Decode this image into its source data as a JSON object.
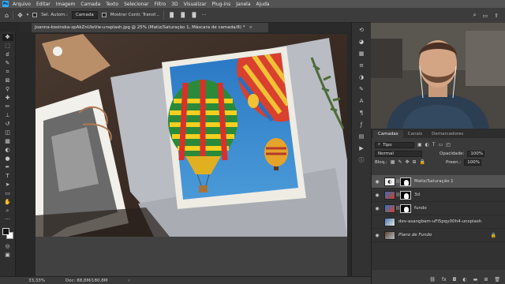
{
  "menu": {
    "logo": "Ps",
    "items": [
      "Arquivo",
      "Editar",
      "Imagem",
      "Camada",
      "Texto",
      "Selecionar",
      "Filtro",
      "3D",
      "Visualizar",
      "Plug-ins",
      "Janela",
      "Ajuda"
    ]
  },
  "options": {
    "home_icon": "home-icon",
    "move_icon": "move-icon",
    "auto_select_label": "Sel. Autom.:",
    "auto_select_target": "Camada",
    "show_transform_label": "Mostrar Contr. Transf..."
  },
  "document": {
    "tab_title": "Joanna-kosinska-spAkZnUleVw-unsplash.jpg @ 25% (Matiz/Saturação 1, Máscara de camada/8) *",
    "close": "×"
  },
  "status": {
    "zoom": "33,33%",
    "doc": "Doc: 88,8M/180,8M"
  },
  "top_right": {
    "icons": [
      "search-icon",
      "workspace-icon",
      "share-icon"
    ]
  },
  "layers_panel": {
    "tabs": [
      "Camadas",
      "Canais",
      "Demarcadores"
    ],
    "active_tab": "Camadas",
    "filter_kind": "Tipo",
    "blend_mode": "Normal",
    "opacity_label": "Opacidade:",
    "opacity_value": "100%",
    "lock_label": "Bloq.:",
    "fill_label": "Preen.:",
    "fill_value": "100%",
    "layers": [
      {
        "name": "Matiz/Saturação 1",
        "visible": true,
        "selected": true,
        "type": "adjustment",
        "italic": false
      },
      {
        "name": "3d",
        "visible": true,
        "selected": false,
        "type": "masked",
        "italic": false
      },
      {
        "name": "fundo",
        "visible": true,
        "selected": false,
        "type": "masked",
        "italic": false
      },
      {
        "name": "dev-asangbam-uFl5pqy00h4-unsplash",
        "visible": false,
        "selected": false,
        "type": "image",
        "italic": false
      },
      {
        "name": "Plano de Fundo",
        "visible": true,
        "selected": false,
        "type": "background",
        "italic": true
      }
    ],
    "bottom_icons": [
      "link-icon",
      "fx-icon",
      "mask-icon",
      "adjustment-icon",
      "folder-icon",
      "new-layer-icon",
      "trash-icon"
    ]
  },
  "colors": {
    "accent": "#31a8ff",
    "panel": "#3a3a3a",
    "selected_layer": "#535353"
  }
}
